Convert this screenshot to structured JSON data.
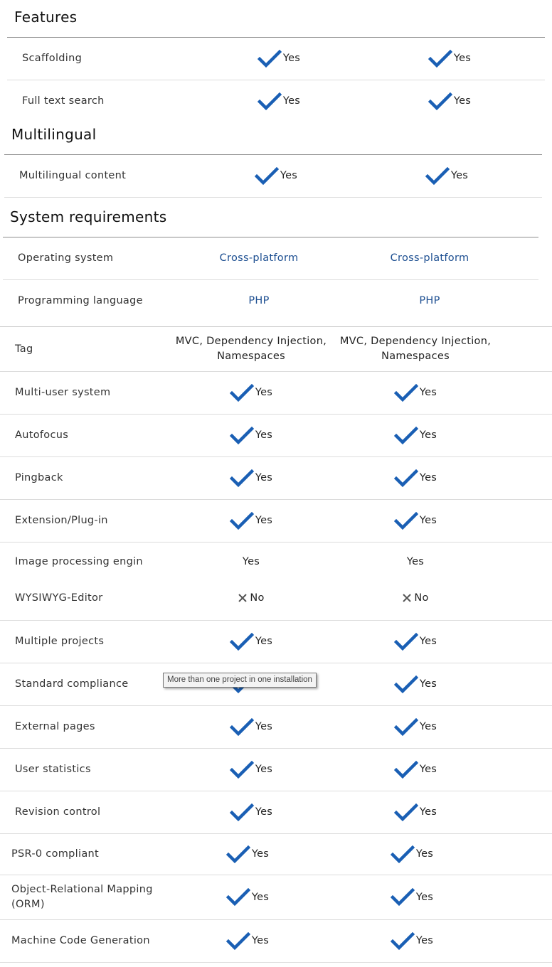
{
  "colors": {
    "check": "#1a5fb4",
    "link": "#1d4f91",
    "cross": "#555555"
  },
  "sections": {
    "features": "Features",
    "multilingual": "Multilingual",
    "system": "System requirements"
  },
  "rows": {
    "scaffolding": {
      "label": "Scaffolding",
      "c1": "Yes",
      "c2": "Yes"
    },
    "full_text_search": {
      "label": "Full text search",
      "c1": "Yes",
      "c2": "Yes"
    },
    "multilingual_content": {
      "label": "Multilingual content",
      "c1": "Yes",
      "c2": "Yes"
    },
    "operating_system": {
      "label": "Operating system",
      "c1": "Cross-platform",
      "c2": "Cross-platform"
    },
    "programming_language": {
      "label": "Programming language",
      "c1": "PHP",
      "c2": "PHP"
    },
    "tag": {
      "label": "Tag",
      "c1": "MVC, Dependency Injection, Namespaces",
      "c2": "MVC, Dependency Injection, Namespaces"
    },
    "multi_user": {
      "label": "Multi-user system",
      "c1": "Yes",
      "c2": "Yes"
    },
    "autofocus": {
      "label": "Autofocus",
      "c1": "Yes",
      "c2": "Yes"
    },
    "pingback": {
      "label": "Pingback",
      "c1": "Yes",
      "c2": "Yes"
    },
    "extension": {
      "label": "Extension/Plug-in",
      "c1": "Yes",
      "c2": "Yes"
    },
    "image_processing": {
      "label": "Image processing engin",
      "c1": "Yes",
      "c2": "Yes"
    },
    "wysiwyg": {
      "label": "WYSIWYG-Editor",
      "c1": "No",
      "c2": "No"
    },
    "multiple_projects": {
      "label": "Multiple projects",
      "c1": "Yes",
      "c2": "Yes"
    },
    "standard_compliance": {
      "label": "Standard compliance",
      "c1": "Yes",
      "c2": "Yes"
    },
    "external_pages": {
      "label": "External pages",
      "c1": "Yes",
      "c2": "Yes"
    },
    "user_statistics": {
      "label": "User statistics",
      "c1": "Yes",
      "c2": "Yes"
    },
    "revision_control": {
      "label": "Revision control",
      "c1": "Yes",
      "c2": "Yes"
    },
    "psr0": {
      "label": "PSR-0 compliant",
      "c1": "Yes",
      "c2": "Yes"
    },
    "orm": {
      "label": "Object-Relational Mapping (ORM)",
      "c1": "Yes",
      "c2": "Yes"
    },
    "codegen": {
      "label": "Machine Code Generation",
      "c1": "Yes",
      "c2": "Yes"
    }
  },
  "tooltip": "More than one project in one installation"
}
